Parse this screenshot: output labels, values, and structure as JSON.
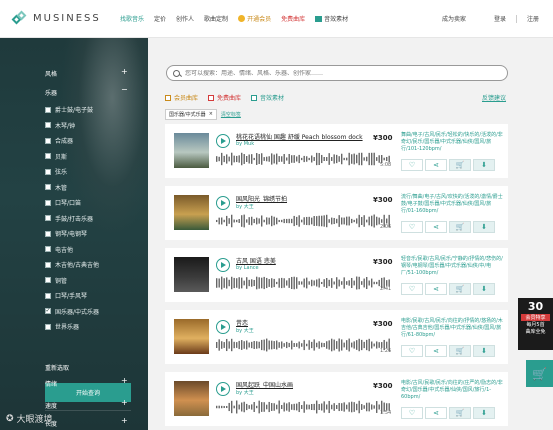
{
  "topnav": {
    "logo": "MUSINESS",
    "items": [
      {
        "label": "找歌音乐",
        "active": true
      },
      {
        "label": "定价"
      },
      {
        "label": "创作人"
      },
      {
        "label": "歌曲定制"
      },
      {
        "label": "开通会员",
        "kind": "vip"
      },
      {
        "label": "免费曲库",
        "kind": "free"
      },
      {
        "label": "音效素材",
        "kind": "sfx"
      }
    ],
    "become_seller": "成为卖家",
    "login": "登录",
    "register": "注册"
  },
  "sidebar": {
    "style_label": "风格",
    "instrument_label": "乐器",
    "instruments": [
      {
        "label": "爵士鼓/电子鼓",
        "checked": false
      },
      {
        "label": "木琴/钟",
        "checked": false
      },
      {
        "label": "合成器",
        "checked": false
      },
      {
        "label": "贝斯",
        "checked": false
      },
      {
        "label": "弦乐",
        "checked": false
      },
      {
        "label": "木管",
        "checked": false
      },
      {
        "label": "口琴/口笛",
        "checked": false
      },
      {
        "label": "手鼓/打击乐器",
        "checked": false
      },
      {
        "label": "钢琴/电钢琴",
        "checked": false
      },
      {
        "label": "电吉他",
        "checked": false
      },
      {
        "label": "木吉他/古典吉他",
        "checked": false
      },
      {
        "label": "铜管",
        "checked": false
      },
      {
        "label": "口琴/手风琴",
        "checked": false
      },
      {
        "label": "国乐器/中式乐器",
        "checked": true
      },
      {
        "label": "世界乐器",
        "checked": false
      }
    ],
    "reset": "重新选取",
    "search_button": "开始查询",
    "mood_label": "情绪",
    "tempo_label": "速度",
    "length_label": "长度",
    "watermark": "大眼渡境"
  },
  "main": {
    "search_placeholder": "您可以搜索：用途、情绪、风格、乐器、创作家……",
    "filters": {
      "vip": "会员曲库",
      "free": "免费曲库",
      "sfx": "音效素材"
    },
    "feedback": "反馈建议",
    "active_tag": "国乐器/中式乐器",
    "tag_close": "×",
    "clear": "清空标签",
    "tracks": [
      {
        "title": "桃花花语桃仙 国趣 舒缓 Peach blossom dock",
        "by": "by Muk",
        "price": "¥300",
        "duration": "5:08",
        "desc": "舞曲/电子/古风/民乐/轻松的/快乐的/活泼的/非奇幻/民乐/国乐器/中式乐器/仙侠/国风/旅行/101-120bpm/",
        "cover": [
          "#6a8a9a",
          "#b8c8c0",
          "#4a5a40"
        ]
      },
      {
        "title": "国风阳光_锦绣节拍",
        "by": "by 大王",
        "price": "¥300",
        "duration": "2:06",
        "desc": "流行/舞曲/电子/古风/欢快的/活泼的/激情/爵士鼓/电子鼓/国乐器/中式乐器/仙侠/国风/旅行/01-160bpm/",
        "cover": [
          "#7a5a2a",
          "#c8a050",
          "#3a5a3a"
        ]
      },
      {
        "title": "古风 国语 悲美",
        "by": "by Lance",
        "price": "¥300",
        "duration": "2:41",
        "desc": "轻音乐/民歌/古风/民乐/宁静的/抒情的/悲伤的/钢琴/电钢琴/国乐器/中式乐器/仙侠/中/电厂/51-100bpm/",
        "cover": [
          "#1a1a1a",
          "#3a3a3a",
          "#5a5a5a"
        ]
      },
      {
        "title": "昔恋",
        "by": "by 大王",
        "price": "¥300",
        "duration": "1:26",
        "desc": "电影/民歌/古风/民乐/向往的/抒情的/悠扬的/木吉他/古典吉他/国乐器/中式乐器/仙侠/国风/旅行/61-80bpm/",
        "cover": [
          "#9a6a2a",
          "#e0b060",
          "#6a3a1a"
        ]
      },
      {
        "title": "国风起跃_中国山水画",
        "by": "by 大王",
        "price": "¥300",
        "duration": "1:54",
        "desc": "电影/古风/民歌/民乐/向往的/庄严的/励志的/非奇幻/国乐器/中式乐器/仙侠/国风/旅行/1-60bpm/",
        "cover": [
          "#6a4a2a",
          "#d09050",
          "#8a6a3a"
        ]
      }
    ]
  },
  "promo": {
    "number": "30",
    "tag": "会员特享",
    "line1": "每月5首",
    "line2": "曲库全免"
  }
}
